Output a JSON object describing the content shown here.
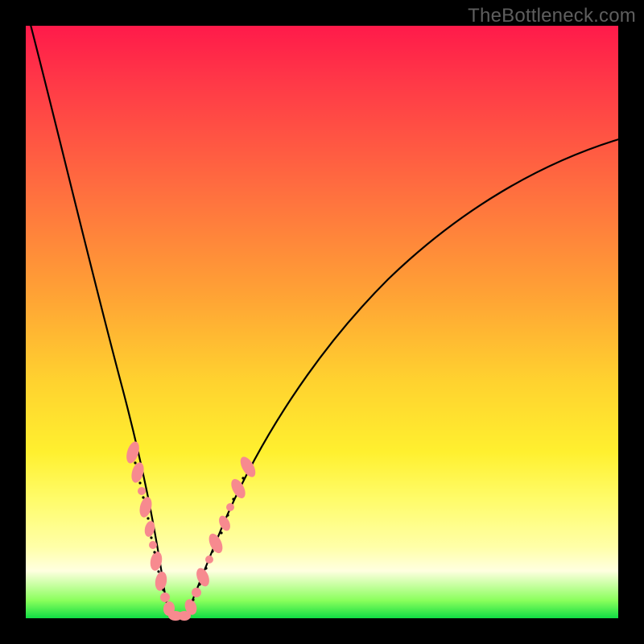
{
  "watermark": "TheBottleneck.com",
  "gradient_colors": {
    "top": "#ff1a4a",
    "mid_upper": "#ff6f3f",
    "mid": "#ffd22f",
    "mid_lower": "#ffffa8",
    "bottom": "#11dd44"
  },
  "chart_data": {
    "type": "line",
    "title": "",
    "xlabel": "",
    "ylabel": "",
    "xlim": [
      0,
      100
    ],
    "ylim": [
      0,
      100
    ],
    "legend": false,
    "grid": false,
    "annotations": [
      "TheBottleneck.com"
    ],
    "series": [
      {
        "name": "left-branch",
        "x": [
          0,
          2,
          4,
          6,
          8,
          10,
          12,
          14,
          16,
          18,
          20,
          21,
          22,
          23
        ],
        "y": [
          100,
          89,
          78,
          68,
          58,
          49,
          40,
          32,
          24,
          16,
          9,
          5,
          2,
          0
        ]
      },
      {
        "name": "right-branch",
        "x": [
          26,
          27,
          28,
          30,
          33,
          37,
          42,
          48,
          55,
          63,
          72,
          82,
          92,
          100
        ],
        "y": [
          0,
          2,
          4,
          8,
          14,
          22,
          31,
          40,
          49,
          57,
          64,
          71,
          76,
          80
        ]
      },
      {
        "name": "minimum-floor",
        "x": [
          23,
          24,
          25,
          26
        ],
        "y": [
          0,
          0,
          0,
          0
        ]
      }
    ],
    "scatter_points": {
      "comment": "pink marker clusters near base of V",
      "color": "#f78a8f",
      "points": [
        {
          "x": 16.5,
          "y": 27
        },
        {
          "x": 17.0,
          "y": 24
        },
        {
          "x": 17.8,
          "y": 21
        },
        {
          "x": 18.8,
          "y": 17
        },
        {
          "x": 19.5,
          "y": 13
        },
        {
          "x": 20.2,
          "y": 10
        },
        {
          "x": 20.8,
          "y": 7
        },
        {
          "x": 21.5,
          "y": 4
        },
        {
          "x": 22.5,
          "y": 2
        },
        {
          "x": 23.5,
          "y": 0.5
        },
        {
          "x": 24.5,
          "y": 0.3
        },
        {
          "x": 25.5,
          "y": 0.5
        },
        {
          "x": 26.5,
          "y": 2
        },
        {
          "x": 27.3,
          "y": 4
        },
        {
          "x": 28.2,
          "y": 7
        },
        {
          "x": 29.4,
          "y": 11
        },
        {
          "x": 30.8,
          "y": 15
        },
        {
          "x": 31.8,
          "y": 18
        },
        {
          "x": 33.2,
          "y": 22
        },
        {
          "x": 34.8,
          "y": 26
        }
      ]
    }
  }
}
